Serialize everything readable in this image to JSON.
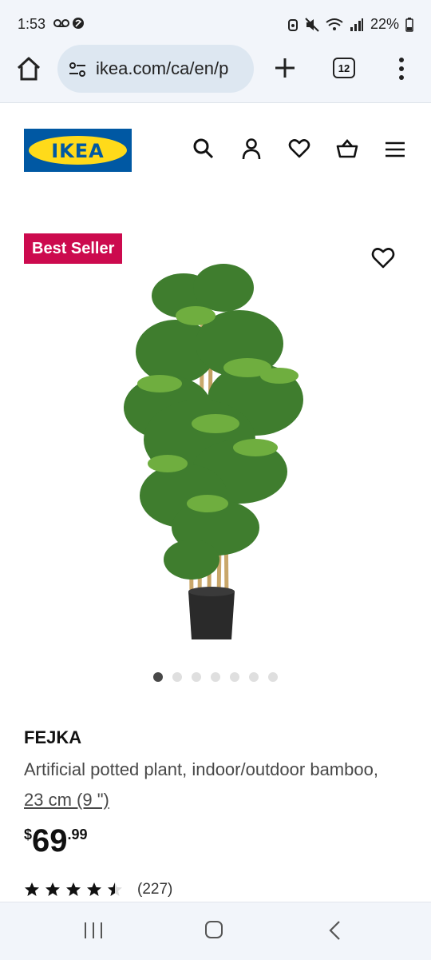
{
  "status_bar": {
    "time": "1:53",
    "left_icons": "voicemail, shazam",
    "battery": "22%"
  },
  "browser": {
    "url": "ikea.com/ca/en/p",
    "tab_count": "12"
  },
  "site": {
    "logo_text": "IKEA",
    "brand_colors": {
      "blue": "#0058a3",
      "yellow": "#ffda1a"
    },
    "nav_icons": [
      "search-icon",
      "account-icon",
      "heart-icon",
      "cart-icon",
      "hamburger-menu-icon"
    ]
  },
  "product": {
    "badge": "Best Seller",
    "badge_color": "#cc0a4e",
    "name": "FEJKA",
    "description": "Artificial potted plant, indoor/outdoor bamboo,",
    "measurement": "23 cm (9 \")",
    "price_currency": "$",
    "price_integer": "69",
    "price_decimal": ".99",
    "rating_stars": 4.5,
    "rating_count": "(227)",
    "image_count": 7,
    "active_image": 1
  }
}
